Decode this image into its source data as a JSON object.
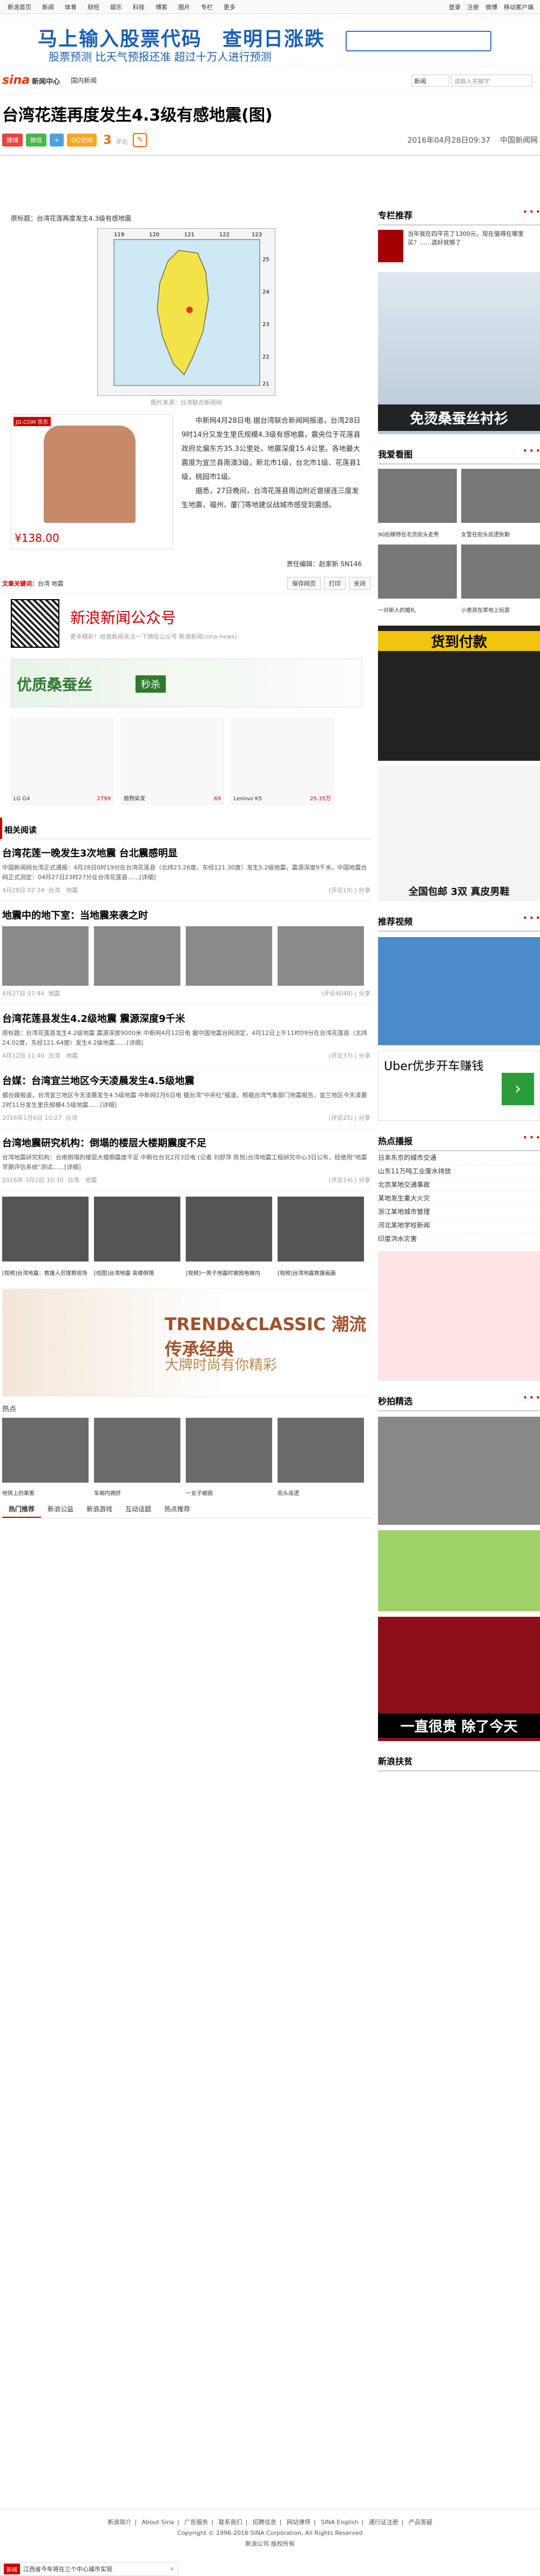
{
  "topnav": [
    "新浪首页",
    "新闻",
    "体育",
    "财经",
    "娱乐",
    "科技",
    "博客",
    "图片",
    "专栏",
    "更多"
  ],
  "topright": {
    "login": "登录",
    "register": "注册",
    "weibo": "微博",
    "mobile": "移动客户端"
  },
  "topad": {
    "line1": "马上输入股票代码　查明日涨跌",
    "line2": "股票预测 比天气预报还准 超过十万人进行预测"
  },
  "header": {
    "logo": "sina",
    "channel": "新闻中心",
    "crumb": "国内新闻",
    "search_sel": "新闻",
    "search_ph": "请输入关键字"
  },
  "article": {
    "title": "台湾花莲再度发生4.3级有感地震(图)",
    "share": {
      "weibo": "微博",
      "weixin": "微信",
      "qq": "QQ空间"
    },
    "comments": "3",
    "comments_unit": "评论",
    "date": "2016年04月28日09:37",
    "source": "中国新闻网",
    "lede": "原标题：台湾花莲再度发生4.3级有感地震",
    "map_caption": "图片来源：台湾联合新闻网",
    "map_labels": [
      "119",
      "120",
      "121",
      "122",
      "123",
      "25",
      "24",
      "23",
      "22",
      "21"
    ],
    "ad_price": "¥138.00",
    "ad_brand": "JD.COM 京东",
    "para1": "中新网4月28日电 据台湾联合新闻网报道，台湾28日9时14分又发生里氏规模4.3级有感地震，震央位于花莲县政府北偏东方35.3公里处，地震深度15.4公里。各地最大震度为宜兰县南澳3级，新北市1级，台北市1级、花莲县1级，桃园市1级。",
    "para2": "据悉，27日晚间，台湾花莲县周边附近曾接连三度发生地震，福州、厦门等地建议战城市感受到震感。",
    "editor": "责任编辑：赵家新 SN146",
    "tags_label": "文章关键词：",
    "tags": "台湾 地震",
    "save": "保存网页",
    "print": "打印",
    "close": "关闭",
    "wechat_title": "新浪新闻公众号",
    "wechat_sub": "更多精彩！给我新闻关注一下微信公众号 新浪新闻(sina-news)",
    "banner1": "优质桑蚕丝",
    "banner1_tag": "秒杀",
    "products": [
      {
        "name": "LG G4",
        "price": "2799"
      },
      {
        "name": "植物染发",
        "price": "69"
      },
      {
        "name": "Lenovo K5",
        "price": "25-35万"
      }
    ]
  },
  "related": {
    "title": "相关阅读",
    "items": [
      {
        "h": "台湾花莲一晚发生3次地震 台北震感明显",
        "sum": "中国新闻网台湾正式通报：4月28日0时19分在台湾花莲县（北纬23.26度，东经121.30度）发生5.2级地震，震源深度9千米。中国地震台网正式测定：04月27日23时27分在台湾花莲县……[详细]",
        "d": "4月28日 02:34",
        "t": "台湾　地震",
        "c": "(评论19) | 分享"
      },
      {
        "h": "地震中的地下室：当地震来袭之时",
        "sum": "",
        "d": "4月27日 07:44",
        "t": "地震",
        "c": "(评论4048) | 分享"
      },
      {
        "h": "台湾花莲县发生4.2级地震 震源深度9千米",
        "sum": "原标题：台湾花莲县发生4.2级地震 震源深度9000米 中新网4月12日电 据中国地震台网测定，4月12日上午11时09分在台湾花莲县（北纬24.02度，东经121.64度）发生4.2级地震……[详细]",
        "d": "4月12日 11:40",
        "t": "台湾　地震",
        "c": "(评论37) | 分享"
      },
      {
        "h": "台媒：台湾宜兰地区今天凌晨发生4.5级地震",
        "sum": "据台媒报道，台湾宜兰地区今天凌晨发生4.5级地震 中新网1月6日电 据台湾\"中央社\"报道，根据台湾气象部门地震报告，宜兰地区今天凌晨2时11分发生里氏规模4.5级地震……[详细]",
        "d": "2016年1月6日 10:27",
        "t": "台湾",
        "c": "(评论25) | 分享"
      },
      {
        "h": "台湾地震研究机构：倒塌的楼层大楼期震度不足",
        "sum": "台湾地震研究机构：台南倒塌的楼层大楼期震度不足 中新社台北2月3日电 (记者 刘舒萍 陈悦)台湾地震工程研究中心3日公布，经使用\"地震早期评估系统\"测试……[详细]",
        "d": "2016年 3月2日 10:30",
        "t": "台湾　地震",
        "c": "(评论14) | 分享"
      }
    ],
    "thumbs": [
      "[视频]台湾地震：救援人员搜救现场",
      "[组图]台湾地震 高楼倒塌",
      "[视频]一男子地震时被困电梯内",
      "[视频]台湾地震救援画面"
    ]
  },
  "bigad": {
    "l1": "TREND&CLASSIC 潮流传承经典",
    "l2": "大牌时尚有你精彩"
  },
  "hot": {
    "title": "热点",
    "items": [
      "地铁上的乘客",
      "车厢内拥挤",
      "一女子被困",
      "街头巡逻"
    ]
  },
  "tabs": [
    "热门推荐",
    "新浪公益",
    "新浪游戏",
    "互动话题",
    "热点推荐"
  ],
  "sidebar": {
    "promo_title": "专栏推荐",
    "promo_text": "当年我在四平花了1300元，现在值得在哪里买？……选好就够了",
    "ad1_label": "免烫桑蚕丝衬衫",
    "pics_title": "我爱看图",
    "pics": [
      "90后模特在北京街头走秀",
      "女警在街头巡逻执勤",
      "一对新人的婚礼",
      "小男孩在草地上玩耍"
    ],
    "ad2_label": "货到付款",
    "ad3_label": "全国包邮 3双 真皮男鞋",
    "video_title": "推荐视频",
    "uber": "Uber优步开车赚钱",
    "hot_title": "热点播报",
    "hot_list": [
      "日本东京的城市交通",
      "山东11万吨工业废水排放",
      "北京某地交通事故",
      "某地发生重大火灾",
      "浙江某地城市管理",
      "河北某地学校新闻",
      "印度洪水灾害"
    ],
    "photo_title": "秒拍精选",
    "bottom_ad": "一直很贵 除了今天",
    "final_title": "新浪扶贫"
  },
  "footer": {
    "links": [
      "新浪简介",
      "About Sina",
      "广告服务",
      "联系我们",
      "招聘信息",
      "网站律师",
      "SINA English",
      "通行证注册",
      "产品答疑"
    ],
    "copy": "Copyright © 1996-2016 SINA Corporation, All Rights Reserved",
    "company": "新浪公司 版权所有"
  },
  "popup": {
    "icon": "新闻",
    "text": "江西省今年将在三个中心城市实现"
  }
}
